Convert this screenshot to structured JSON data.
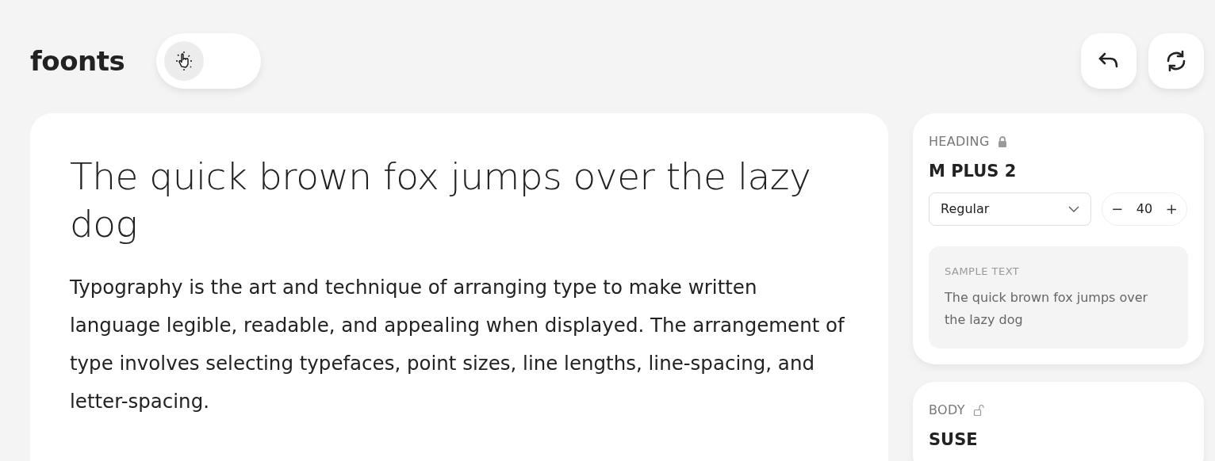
{
  "app": {
    "logo": "foonts",
    "cursor_toggle": {
      "on": false
    }
  },
  "preview": {
    "heading": "The quick brown fox jumps over the lazy dog",
    "paragraph": "Typography is the art and technique of arranging type to make written language legible, readable, and appealing when displayed. The arrangement of type involves selecting typefaces, point sizes, line lengths, line-spacing, and letter-spacing."
  },
  "panels": [
    {
      "label": "HEADING",
      "locked": true,
      "font": "M PLUS 2",
      "weight": "Regular",
      "decrease": "−",
      "size": "40",
      "increase": "+",
      "sample_label": "SAMPLE TEXT",
      "sample": "The quick brown fox jumps over the lazy dog"
    },
    {
      "label": "BODY",
      "locked": false,
      "font": "SUSE"
    }
  ]
}
